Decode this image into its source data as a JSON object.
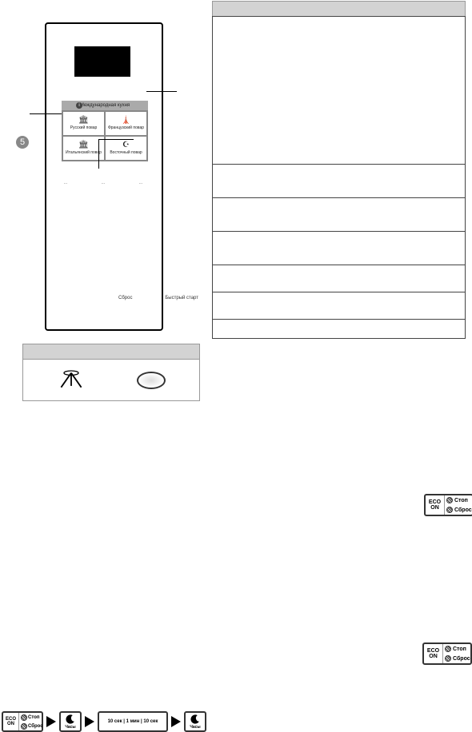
{
  "callout_number": "5",
  "cuisine": {
    "header": "Международная кухня",
    "badge": "i",
    "cells": [
      {
        "label": "Русский повар",
        "icon": "🏛"
      },
      {
        "label": "Французский повар",
        "icon": "🗼"
      },
      {
        "label": "Итальянский повар",
        "icon": "🏛"
      },
      {
        "label": "Восточный повар",
        "icon": "☪"
      }
    ]
  },
  "middle_labels": {
    "left": "...",
    "center": "...",
    "right": "..."
  },
  "bottom_labels": {
    "left": "Сброс",
    "right": "Быстрый старт"
  },
  "eco_stop": {
    "eco": "ECO",
    "on": "ON",
    "stop": "Стоп",
    "reset": "Сброс"
  },
  "sequence": {
    "clock_label": "Часы",
    "times": "10 сек  |  1 мин  |  10 сек"
  }
}
